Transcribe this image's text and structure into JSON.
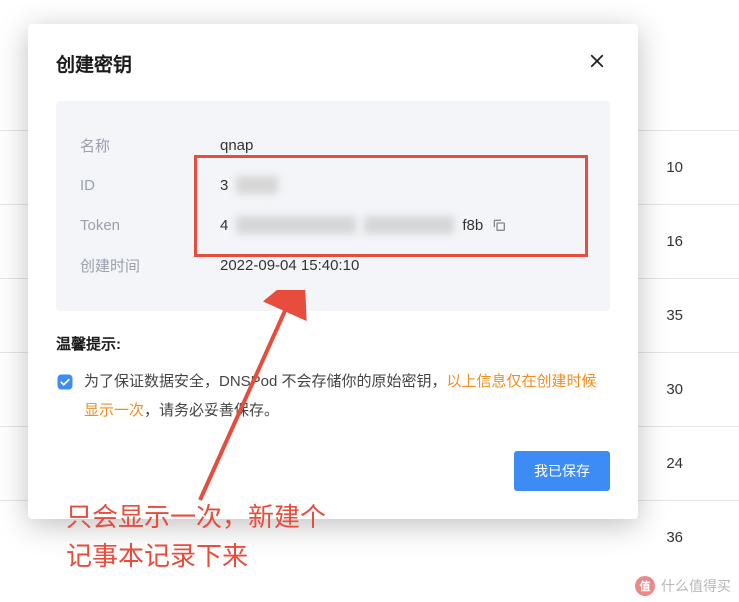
{
  "bg_rows": [
    "10",
    "16",
    "35",
    "30",
    "24",
    "36"
  ],
  "modal": {
    "title": "创建密钥",
    "info": {
      "name_label": "名称",
      "name_value": "qnap",
      "id_label": "ID",
      "id_prefix": "3",
      "token_label": "Token",
      "token_prefix": "4",
      "token_suffix": "f8b",
      "created_label": "创建时间",
      "created_value": "2022-09-04 15:40:10"
    },
    "tips": {
      "header": "温馨提示:",
      "text_part1": "为了保证数据安全，DNSPod 不会存储你的原始密钥，",
      "highlight": "以上信息仅在创建时候显示一次",
      "text_part2": "，请务必妥善保存。"
    },
    "save_button": "我已保存"
  },
  "annotation": {
    "line1": "只会显示一次，新建个",
    "line2": "记事本记录下来"
  },
  "watermark": "什么值得买"
}
